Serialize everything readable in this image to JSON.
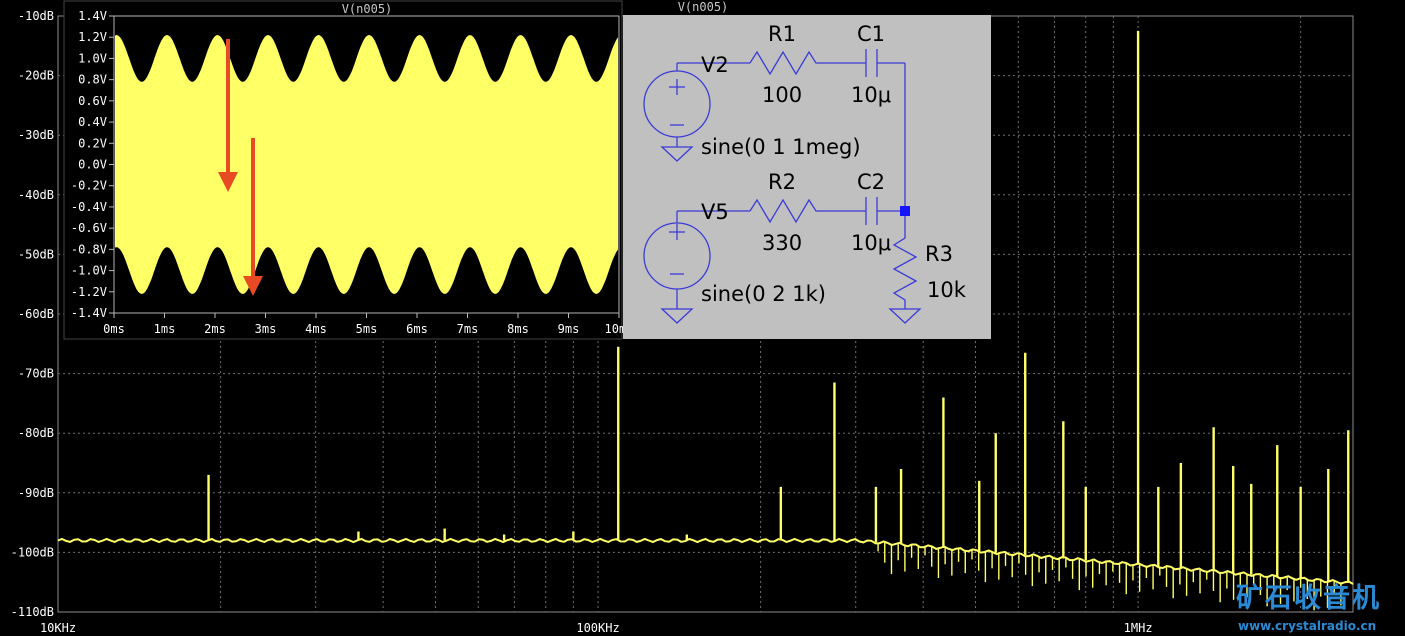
{
  "chart_data": [
    {
      "type": "line",
      "title": "V(n005)",
      "xscale": "log",
      "xlim_hz": [
        10000,
        2500000
      ],
      "ylim": [
        -110,
        -10
      ],
      "grid": true,
      "yticks": [
        "-10dB",
        "-20dB",
        "-30dB",
        "-40dB",
        "-50dB",
        "-60dB",
        "-70dB",
        "-80dB",
        "-90dB",
        "-100dB",
        "-110dB"
      ],
      "xticks": [
        {
          "label": "10KHz",
          "hz": 10000
        },
        {
          "label": "100KHz",
          "hz": 100000
        },
        {
          "label": "1MHz",
          "hz": 1000000
        }
      ],
      "noise_floor_db": -98,
      "spikes": [
        {
          "hz": 19000,
          "db": -87
        },
        {
          "hz": 36000,
          "db": -96.5
        },
        {
          "hz": 52000,
          "db": -96
        },
        {
          "hz": 67000,
          "db": -97
        },
        {
          "hz": 90000,
          "db": -96.5
        },
        {
          "hz": 109000,
          "db": -65.5
        },
        {
          "hz": 146000,
          "db": -97
        },
        {
          "hz": 218000,
          "db": -89
        },
        {
          "hz": 274000,
          "db": -71.5
        },
        {
          "hz": 327000,
          "db": -89
        },
        {
          "hz": 364000,
          "db": -86
        },
        {
          "hz": 436000,
          "db": -74
        },
        {
          "hz": 508000,
          "db": -88
        },
        {
          "hz": 545000,
          "db": -80
        },
        {
          "hz": 618000,
          "db": -66.5
        },
        {
          "hz": 727000,
          "db": -78
        },
        {
          "hz": 800000,
          "db": -89
        },
        {
          "hz": 1000000,
          "db": -12.5
        },
        {
          "hz": 1090000,
          "db": -89
        },
        {
          "hz": 1200000,
          "db": -85
        },
        {
          "hz": 1380000,
          "db": -79
        },
        {
          "hz": 1500000,
          "db": -85.5
        },
        {
          "hz": 1620000,
          "db": -88.5
        },
        {
          "hz": 1810000,
          "db": -82
        },
        {
          "hz": 2000000,
          "db": -89
        },
        {
          "hz": 2250000,
          "db": -86
        },
        {
          "hz": 2450000,
          "db": -79.5
        }
      ]
    },
    {
      "type": "line",
      "title": "V(n005)",
      "xlim_ms": [
        0,
        10
      ],
      "ylim": [
        -1.4,
        1.4
      ],
      "grid": false,
      "xticks": [
        "0ms",
        "1ms",
        "2ms",
        "3ms",
        "4ms",
        "5ms",
        "6ms",
        "7ms",
        "8ms",
        "9ms",
        "10ms"
      ],
      "yticks": [
        "1.4V",
        "1.2V",
        "1.0V",
        "0.8V",
        "0.6V",
        "0.4V",
        "0.2V",
        "0.0V",
        "-0.2V",
        "-0.4V",
        "-0.6V",
        "-0.8V",
        "-1.0V",
        "-1.2V",
        "-1.4V"
      ],
      "envelope": {
        "carrier_amplitude_v": 1,
        "carrier_hz": 1000000,
        "modulation_amplitude_v": 0.22,
        "modulation_hz": 1000
      },
      "fill_color": "#ffff66",
      "arrow_color": "#e84a24"
    }
  ],
  "schematic": {
    "sources": [
      {
        "name": "V2",
        "value": "sine(0 1 1meg)"
      },
      {
        "name": "V5",
        "value": "sine(0 2 1k)"
      }
    ],
    "parts": [
      {
        "name": "R1",
        "value": "100"
      },
      {
        "name": "C1",
        "value": "10μ"
      },
      {
        "name": "R2",
        "value": "330"
      },
      {
        "name": "C2",
        "value": "10μ"
      },
      {
        "name": "R3",
        "value": "10k"
      }
    ]
  },
  "watermark": {
    "text": "矿石收音机",
    "url": "www.crystalradio.cn"
  },
  "colors": {
    "trace": "#ffff66",
    "grid": "#6e6e6e",
    "schematic_bg": "#c0c0c0",
    "wire": "#3b3bd8",
    "logo": "#2a8ad4"
  }
}
